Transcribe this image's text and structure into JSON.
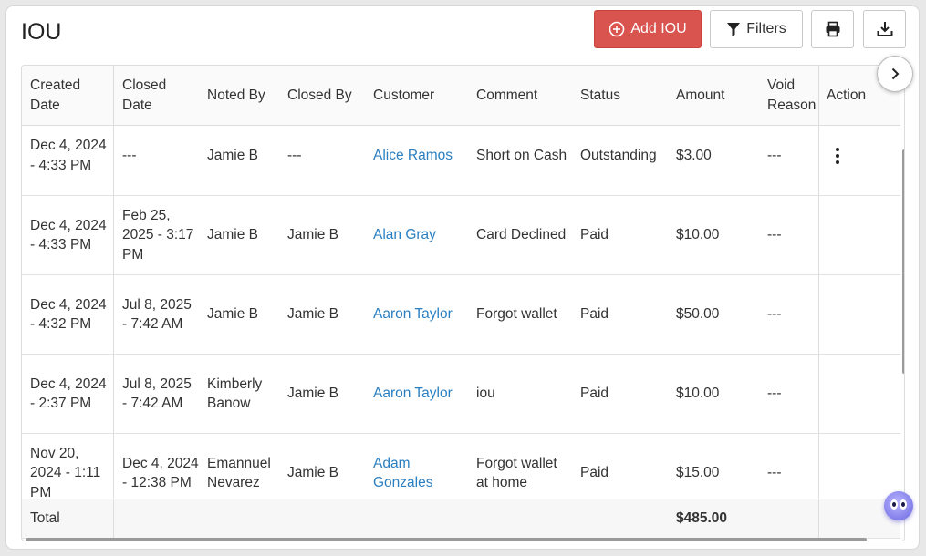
{
  "page": {
    "title": "IOU"
  },
  "toolbar": {
    "add_label": "Add IOU",
    "filters_label": "Filters"
  },
  "colors": {
    "accent": "#d9534f",
    "link": "#2a7fc1"
  },
  "table": {
    "headers": {
      "created_date": "Created Date",
      "closed_date": "Closed Date",
      "noted_by": "Noted By",
      "closed_by": "Closed By",
      "customer": "Customer",
      "comment": "Comment",
      "status": "Status",
      "amount": "Amount",
      "void_reason": "Void Reason",
      "action": "Action"
    },
    "rows": [
      {
        "created": "Dec 4, 2024 - 4:33 PM",
        "closed": "---",
        "noted_by": "Jamie B",
        "closed_by": "---",
        "customer": "Alice Ramos",
        "comment": "Short on Cash",
        "status": "Outstanding",
        "amount": "$3.00",
        "void_reason": "---",
        "has_action": true
      },
      {
        "created": "Dec 4, 2024 - 4:33 PM",
        "closed": "Feb 25, 2025 - 3:17 PM",
        "noted_by": "Jamie B",
        "closed_by": "Jamie B",
        "customer": "Alan Gray",
        "comment": "Card Declined",
        "status": "Paid",
        "amount": "$10.00",
        "void_reason": "---",
        "has_action": false
      },
      {
        "created": "Dec 4, 2024 - 4:32 PM",
        "closed": "Jul 8, 2025 - 7:42 AM",
        "noted_by": "Jamie B",
        "closed_by": "Jamie B",
        "customer": "Aaron Taylor",
        "comment": "Forgot wallet",
        "status": "Paid",
        "amount": "$50.00",
        "void_reason": "---",
        "has_action": false
      },
      {
        "created": "Dec 4, 2024 - 2:37 PM",
        "closed": "Jul 8, 2025 - 7:42 AM",
        "noted_by": "Kimberly Banow",
        "closed_by": "Jamie B",
        "customer": "Aaron Taylor",
        "comment": "iou",
        "status": "Paid",
        "amount": "$10.00",
        "void_reason": "---",
        "has_action": false
      },
      {
        "created": "Nov 20, 2024 - 1:11 PM",
        "closed": "Dec 4, 2024 - 12:38 PM",
        "noted_by": "Emannuel Nevarez",
        "closed_by": "Jamie B",
        "customer": "Adam Gonzales",
        "comment": "Forgot wallet at home",
        "status": "Paid",
        "amount": "$15.00",
        "void_reason": "---",
        "has_action": false
      }
    ],
    "total_label": "Total",
    "total_amount": "$485.00"
  },
  "icons": {
    "add": "plus-circle-icon",
    "filters": "funnel-icon",
    "print": "printer-icon",
    "download": "download-icon",
    "next": "chevron-right-icon",
    "action": "kebab-menu-icon",
    "assistant": "chat-bot-icon"
  }
}
